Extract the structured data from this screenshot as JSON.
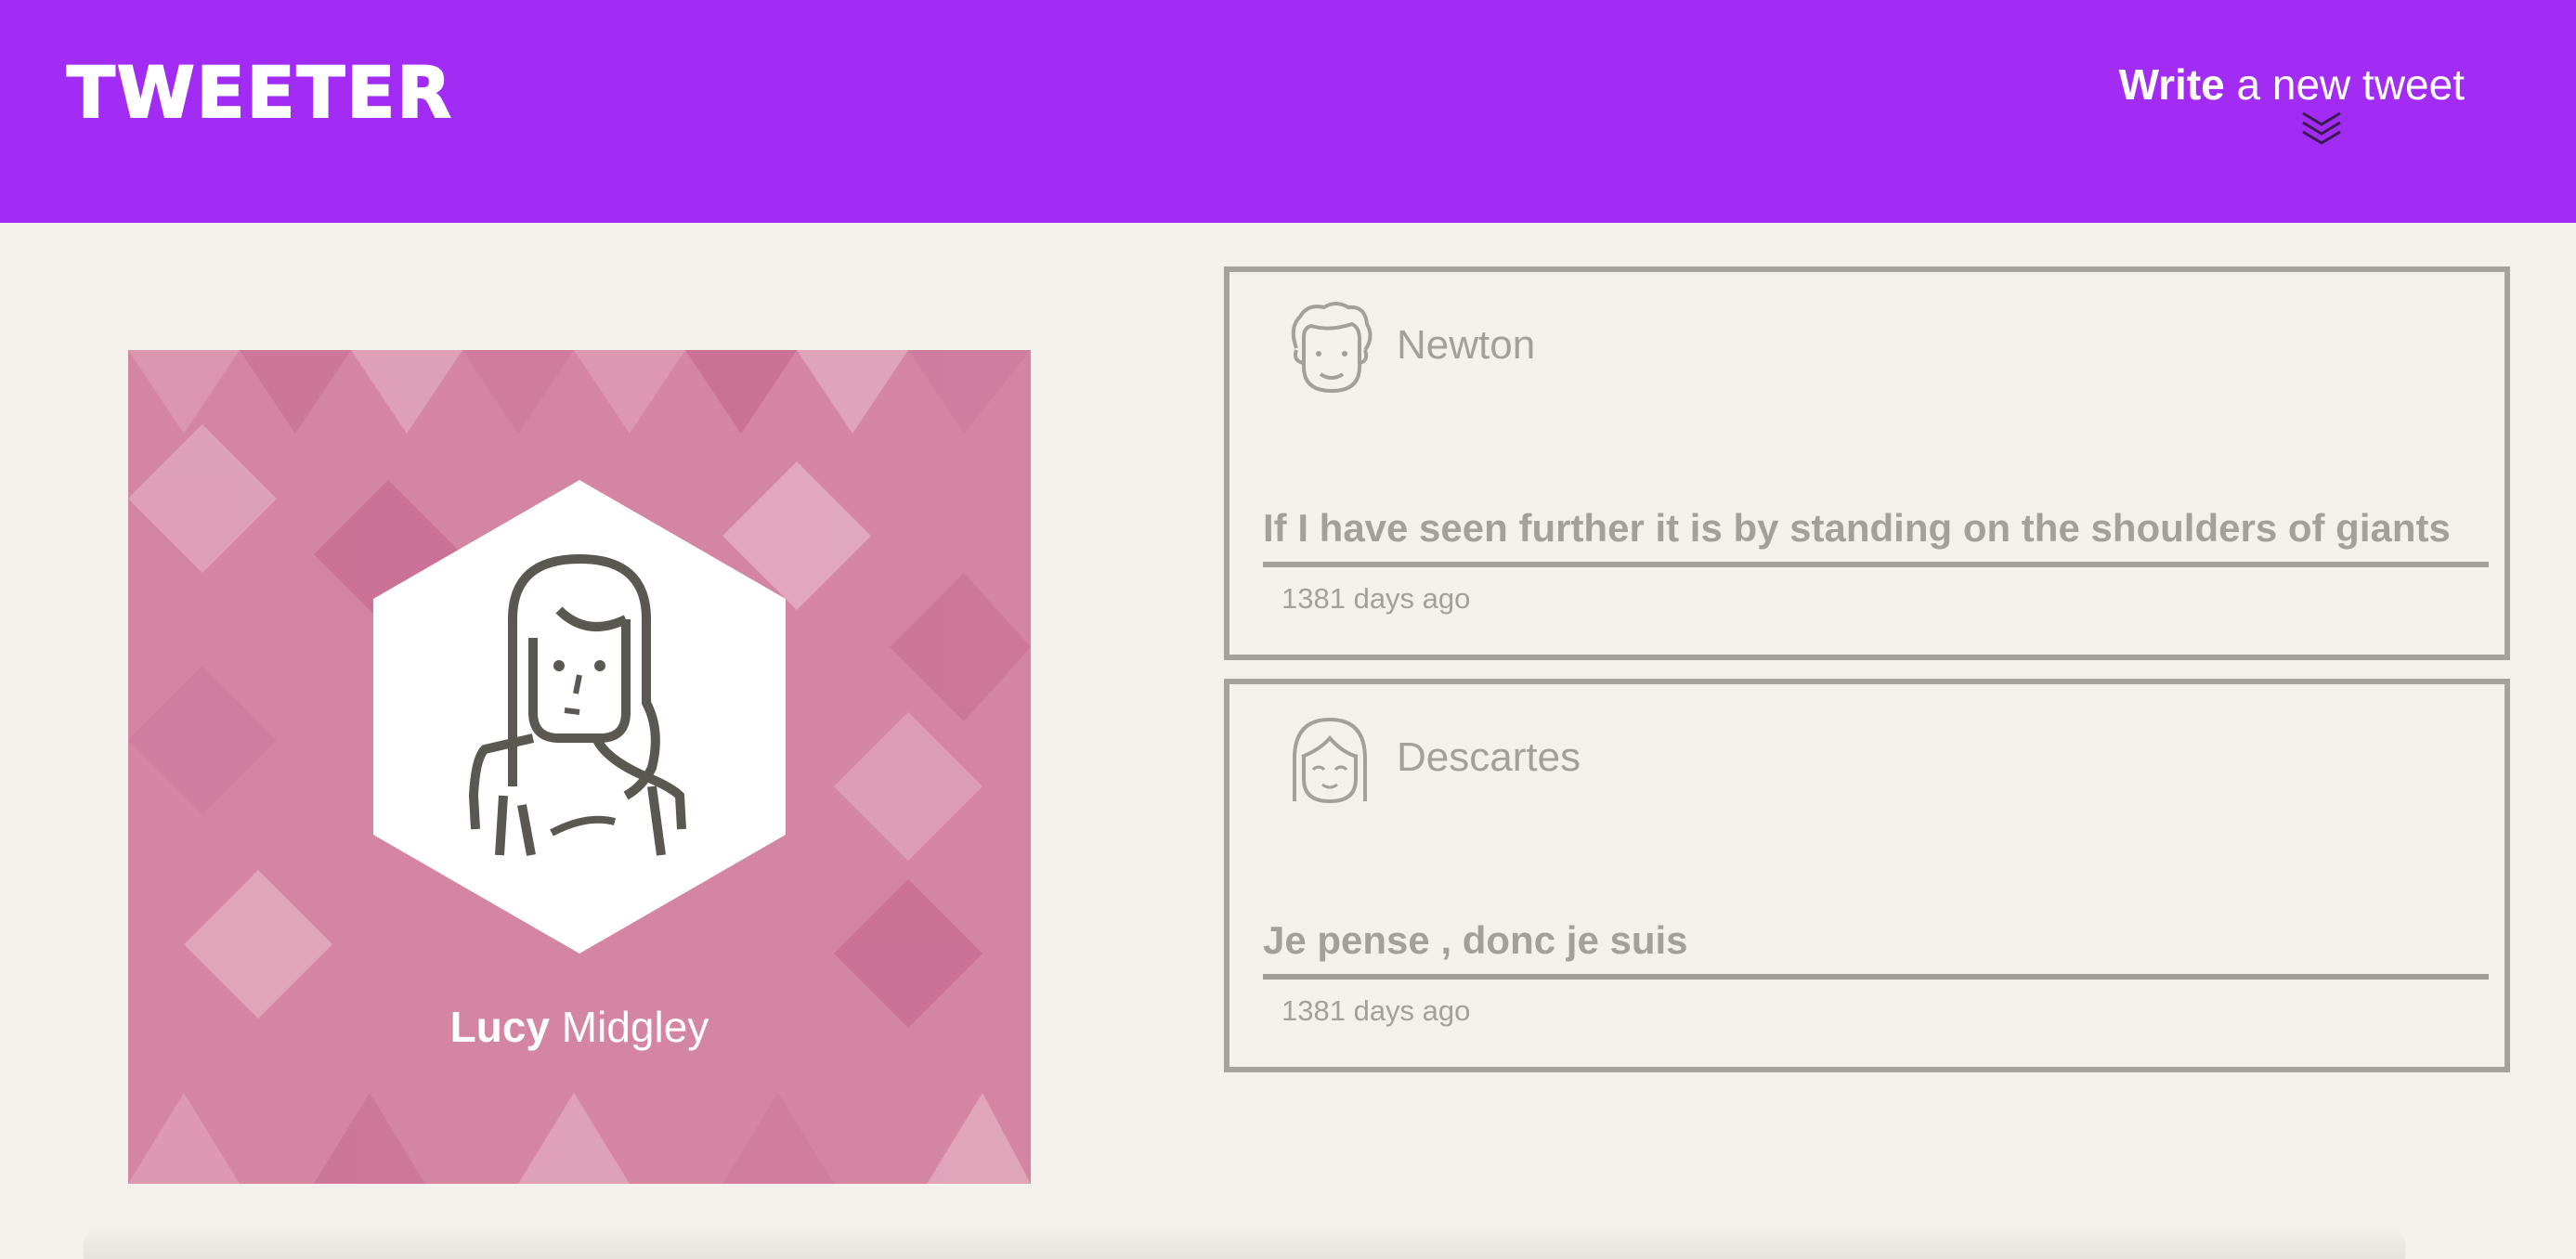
{
  "header": {
    "logo": "TWEETER",
    "compose_strong": "Write",
    "compose_rest": " a new tweet",
    "compose_icon": "double-chevron-down-icon",
    "background_color": "#a22cf4"
  },
  "profile": {
    "first_name": "Lucy",
    "last_name": " Midgley",
    "avatar_icon": "woman-avatar-icon",
    "card_color": "#d485a2"
  },
  "tweets": [
    {
      "author": "Newton",
      "avatar_icon": "curly-hair-man-avatar-icon",
      "text": "If I have seen further it is by standing on the shoulders of giants",
      "time": "1381 days ago"
    },
    {
      "author": "Descartes",
      "avatar_icon": "bangs-avatar-icon",
      "text": "Je pense , donc je suis",
      "time": "1381 days ago"
    }
  ],
  "colors": {
    "page_background": "#f4f1ec",
    "muted_text": "#a3a09a"
  }
}
